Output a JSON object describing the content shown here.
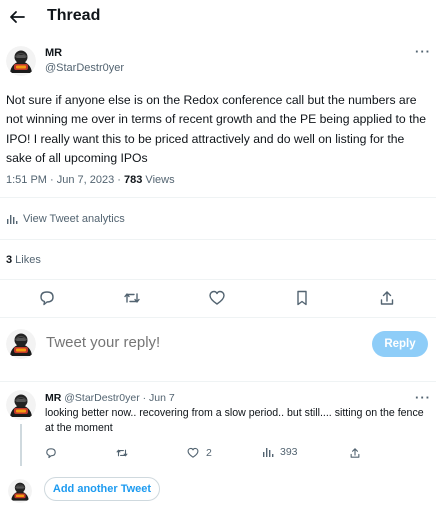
{
  "header": {
    "title": "Thread"
  },
  "tweet": {
    "author_name": "MR",
    "author_handle": "@StarDestr0yer",
    "text": "Not sure if anyone else is on the Redox conference call but the numbers are not winning me over in terms of recent growth and the PE being applied to the IPO!  I really want this to be priced attractively and do well on listing for the sake of all upcoming IPOs",
    "time": "1:51 PM · Jun 7, 2023 · ",
    "views_count": "783",
    "views_label": " Views",
    "analytics_label": "View Tweet analytics",
    "likes_count": "3",
    "likes_label": " Likes"
  },
  "composer": {
    "placeholder": "Tweet your reply!",
    "reply_button": "Reply"
  },
  "reply": {
    "author_name": "MR",
    "author_handle": "@StarDestr0yer · Jun 7",
    "text": "looking better now.. recovering from a slow period.. but still.... sitting on the fence at the moment",
    "likes": "2",
    "views": "393"
  },
  "add_tweet_label": "Add another Tweet",
  "icons": {
    "back": "arrow-left-icon",
    "more": "more-dots-icon",
    "reply": "comment-icon",
    "retweet": "retweet-icon",
    "like": "heart-icon",
    "bookmark": "bookmark-icon",
    "share": "share-icon",
    "analytics": "bar-chart-icon"
  },
  "colors": {
    "accent": "#1d9bf0",
    "reply_button_disabled": "#8ecdf8",
    "text_secondary": "#536471"
  }
}
